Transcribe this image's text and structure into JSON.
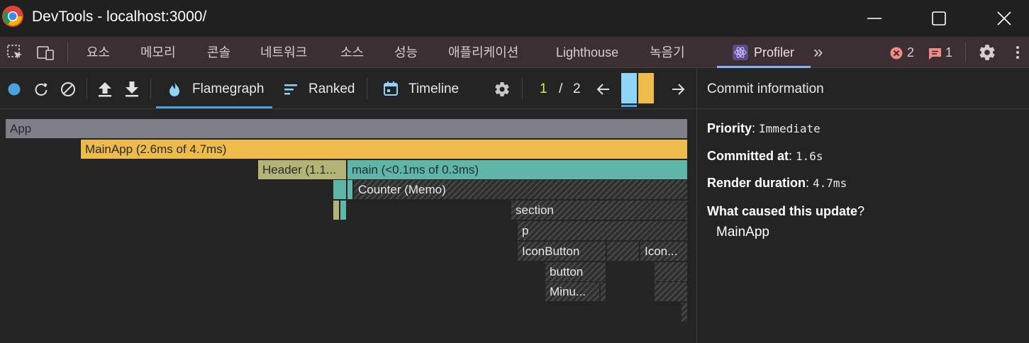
{
  "window": {
    "title": "DevTools - localhost:3000/"
  },
  "tabs": [
    {
      "label": "요소"
    },
    {
      "label": "메모리"
    },
    {
      "label": "콘솔"
    },
    {
      "label": "네트워크"
    },
    {
      "label": "소스"
    },
    {
      "label": "성능"
    },
    {
      "label": "애플리케이션"
    },
    {
      "label": "Lighthouse"
    },
    {
      "label": "녹음기"
    },
    {
      "label": "Profiler"
    }
  ],
  "more_tabs": "»",
  "status": {
    "errors": "2",
    "messages": "1",
    "error_color": "#f28b82",
    "message_color": "#f28b82"
  },
  "profiler_toolbar": {
    "flamegraph_label": "Flamegraph",
    "ranked_label": "Ranked",
    "timeline_label": "Timeline",
    "commit_current": "1",
    "commit_sep": "/",
    "commit_total": "2"
  },
  "flamegraph": {
    "bars": [
      {
        "label": "App",
        "color": "#7e7f88"
      },
      {
        "label": "MainApp (2.6ms of 4.7ms)",
        "color": "#edbb4c"
      },
      {
        "label": "Header (1.1...",
        "color": "#b3b577"
      },
      {
        "label": "main (<0.1ms of 0.3ms)",
        "color": "#5fb6a8"
      },
      {
        "label": "Counter (Memo)",
        "color": "hatched"
      },
      {
        "label": "section",
        "color": "hatched"
      },
      {
        "label": "p",
        "color": "hatched"
      },
      {
        "label": "IconButton",
        "color": "hatched"
      },
      {
        "label": "Icon...",
        "color": "hatched"
      },
      {
        "label": "button",
        "color": "hatched"
      },
      {
        "label": "Minu...",
        "color": "hatched"
      }
    ]
  },
  "commit_info": {
    "title": "Commit information",
    "priority_label": "Priority",
    "priority_value": "Immediate",
    "committed_label": "Committed at",
    "committed_value": "1.6s",
    "duration_label": "Render duration",
    "duration_value": "4.7ms",
    "cause_label": "What caused this update",
    "cause_suffix": "?",
    "cause_value": "MainApp"
  },
  "colors": {
    "accent": "#4aa3df",
    "commit_bar_1": "#8fd3f5",
    "commit_bar_2": "#edbb4c",
    "record_dot": "#4aa3df"
  }
}
